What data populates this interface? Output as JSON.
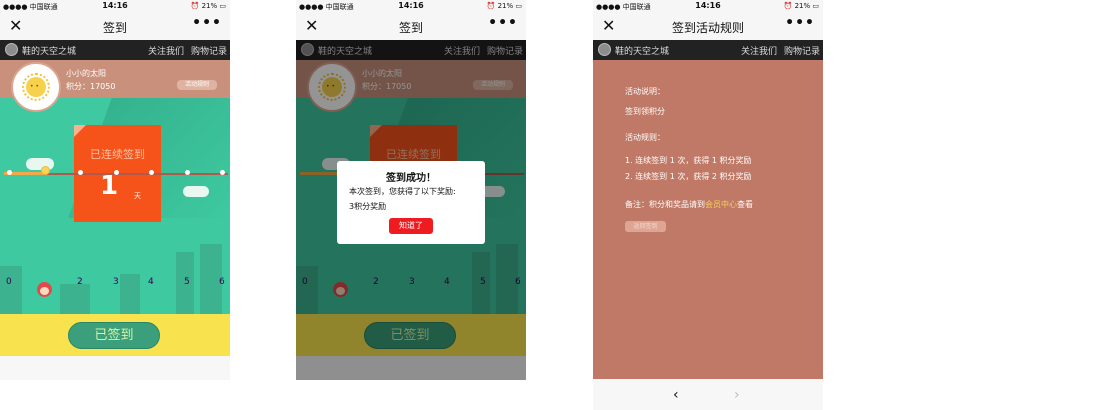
{
  "status_bar": {
    "carrier": "中国联通",
    "time": "14:16",
    "battery": "21%"
  },
  "shop_bar": {
    "name": "鞋的天空之城",
    "follow": "关注我们",
    "orders": "购物记录"
  },
  "user": {
    "name": "小小的太阳",
    "points": "积分：17050"
  },
  "screen1": {
    "nav_title": "签到",
    "rules_button": "活动规则",
    "card_label": "已连续签到",
    "streak_days": "1",
    "streak_unit": "天",
    "timeline_ticks": [
      "0",
      "2",
      "3",
      "4",
      "5",
      "6"
    ],
    "signed_button": "已签到"
  },
  "screen2": {
    "nav_title": "签到",
    "dialog": {
      "title": "签到成功！",
      "line1": "本次签到，您获得了以下奖励:",
      "line2": "3积分奖励",
      "ok_button": "知道了"
    }
  },
  "screen3": {
    "nav_title": "签到活动规则",
    "desc_title": "活动说明：",
    "desc_text": "签到领积分",
    "rules_title": "活动规则：",
    "rule1": "1. 连续签到 1 次，获得 1 积分奖励",
    "rule2": "2. 连续签到 1 次，获得 2 积分奖励",
    "note_prefix": "备注：积分和奖品请到",
    "note_link": "会员中心",
    "note_suffix": "查看",
    "back_button": "返回签到",
    "nav_back": "‹",
    "nav_forward": "›"
  },
  "icons": {
    "close": "close-icon",
    "more": "more-icon",
    "wifi": "wifi-icon",
    "signal": "signal-icon",
    "battery": "battery-icon",
    "sun_avatar": "sun-avatar-icon"
  },
  "colors": {
    "accent_green": "#3ec9a0",
    "card_orange": "#f5531a",
    "header_salmon": "#c9917c",
    "footer_yellow": "#f8e34e",
    "dialog_red": "#ee1c20",
    "rules_bg": "#c07966"
  }
}
